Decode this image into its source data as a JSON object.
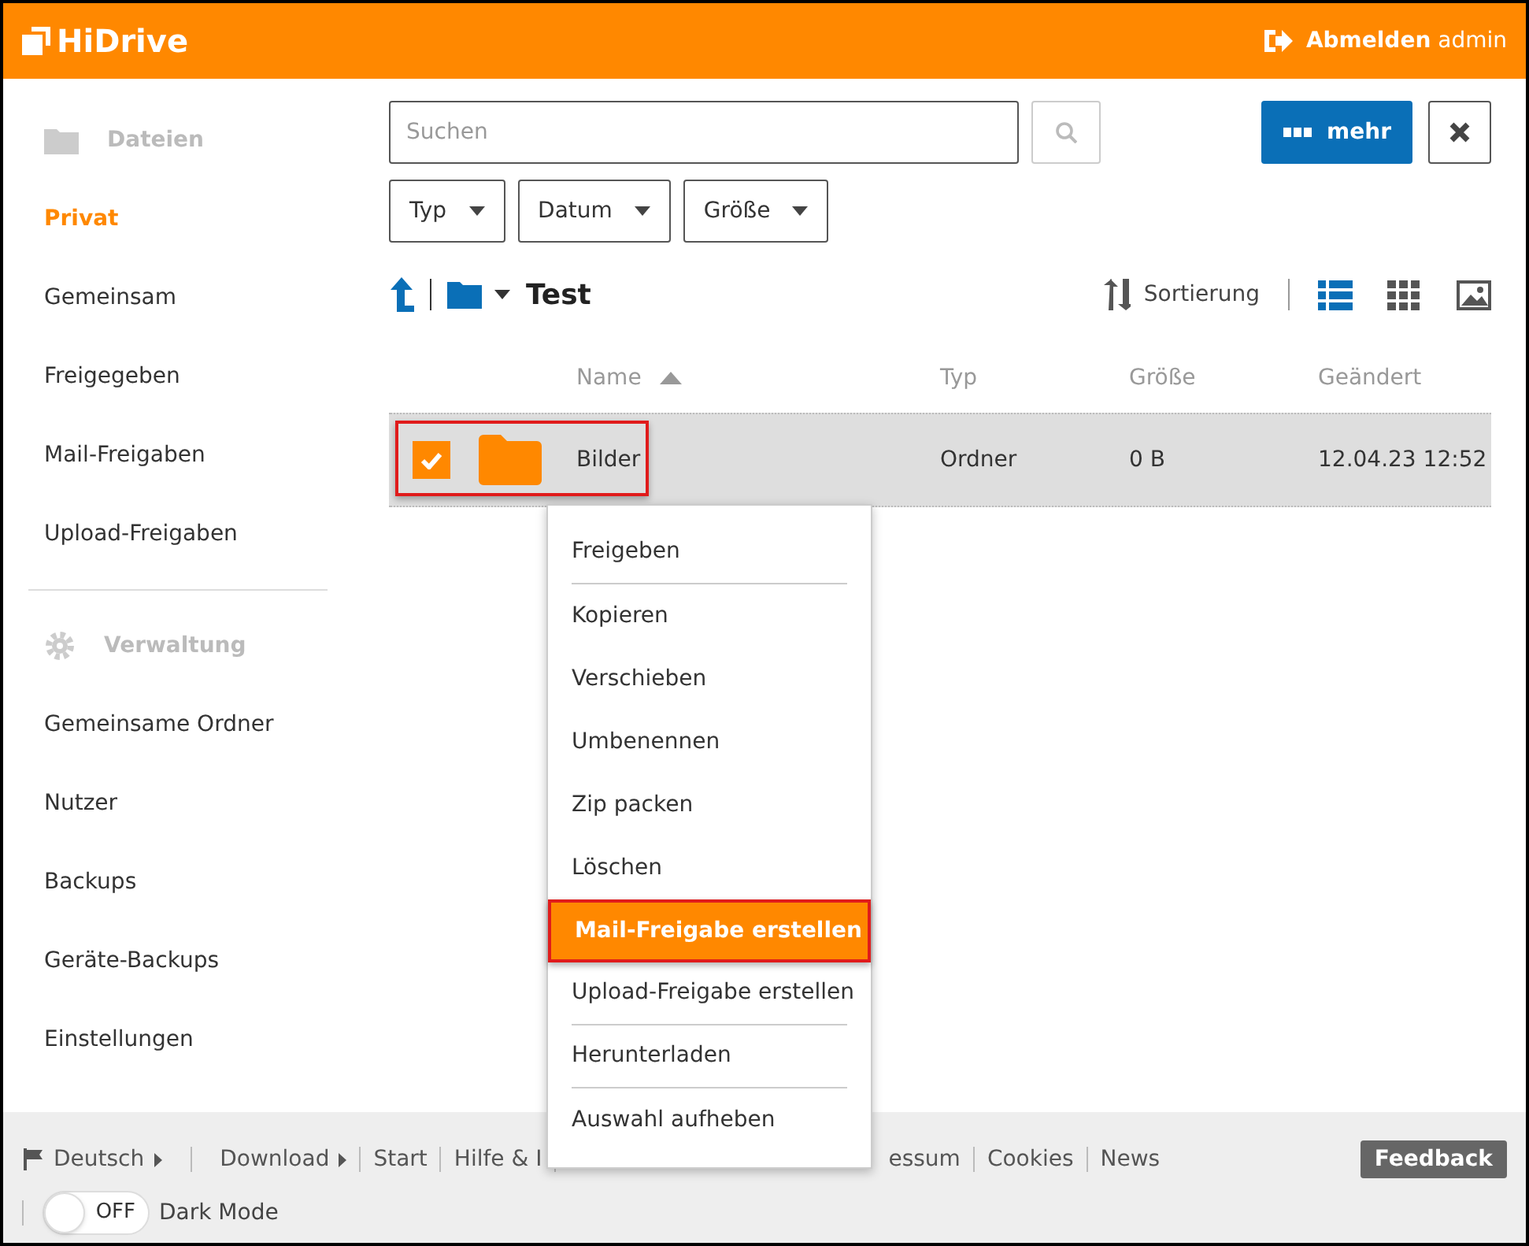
{
  "header": {
    "logo": "HiDrive",
    "logout": "Abmelden",
    "user": "admin"
  },
  "sidebar": {
    "groups": [
      {
        "title": "Dateien",
        "items": [
          {
            "label": "Privat",
            "selected": true
          },
          {
            "label": "Gemeinsam",
            "selected": false
          },
          {
            "label": "Freigegeben",
            "selected": false
          },
          {
            "label": "Mail-Freigaben",
            "selected": false
          },
          {
            "label": "Upload-Freigaben",
            "selected": false
          }
        ]
      },
      {
        "title": "Verwaltung",
        "items": [
          {
            "label": "Gemeinsame Ordner",
            "selected": false
          },
          {
            "label": "Nutzer",
            "selected": false
          },
          {
            "label": "Backups",
            "selected": false
          },
          {
            "label": "Geräte-Backups",
            "selected": false
          },
          {
            "label": "Einstellungen",
            "selected": false
          }
        ]
      }
    ]
  },
  "search": {
    "placeholder": "Suchen"
  },
  "more_button": "mehr",
  "filters": [
    "Typ",
    "Datum",
    "Größe"
  ],
  "breadcrumb": {
    "folder": "Test"
  },
  "sort_label": "Sortierung",
  "views": [
    {
      "kind": "list",
      "selected": true
    },
    {
      "kind": "grid",
      "selected": false
    },
    {
      "kind": "gallery",
      "selected": false
    }
  ],
  "table": {
    "columns": [
      {
        "label": "Name",
        "sorted": true
      },
      {
        "label": "Typ",
        "sorted": false
      },
      {
        "label": "Größe",
        "sorted": false
      },
      {
        "label": "Geändert",
        "sorted": false
      }
    ],
    "rows": [
      {
        "name": "Bilder",
        "type": "Ordner",
        "size": "0 B",
        "modified": "12.04.23 12:52",
        "checked": true,
        "selected": true,
        "annotated": true
      }
    ]
  },
  "context_menu": [
    {
      "label": "Freigeben",
      "highlighted": false,
      "divider_after": true
    },
    {
      "label": "Kopieren",
      "highlighted": false,
      "divider_after": false
    },
    {
      "label": "Verschieben",
      "highlighted": false,
      "divider_after": false
    },
    {
      "label": "Umbenennen",
      "highlighted": false,
      "divider_after": false
    },
    {
      "label": "Zip packen",
      "highlighted": false,
      "divider_after": false
    },
    {
      "label": "Löschen",
      "highlighted": false,
      "divider_after": false
    },
    {
      "label": "Mail-Freigabe erstellen",
      "highlighted": true,
      "divider_after": false
    },
    {
      "label": "Upload-Freigabe erstellen",
      "highlighted": false,
      "divider_after": true
    },
    {
      "label": "Herunterladen",
      "highlighted": false,
      "divider_after": true
    },
    {
      "label": "Auswahl aufheben",
      "highlighted": false,
      "divider_after": false
    }
  ],
  "footer": {
    "links": [
      {
        "label": "Deutsch",
        "kind": "language"
      },
      {
        "label": "Download",
        "kind": "menu"
      },
      {
        "label": "Start",
        "kind": "link"
      },
      {
        "label": "Hilfe & I",
        "kind": "link"
      },
      {
        "label": "essum",
        "kind": "link"
      },
      {
        "label": "Cookies",
        "kind": "link"
      },
      {
        "label": "News",
        "kind": "link"
      }
    ],
    "feedback": "Feedback",
    "dark_mode": {
      "on": false,
      "state": "OFF",
      "label": "Dark Mode"
    }
  }
}
